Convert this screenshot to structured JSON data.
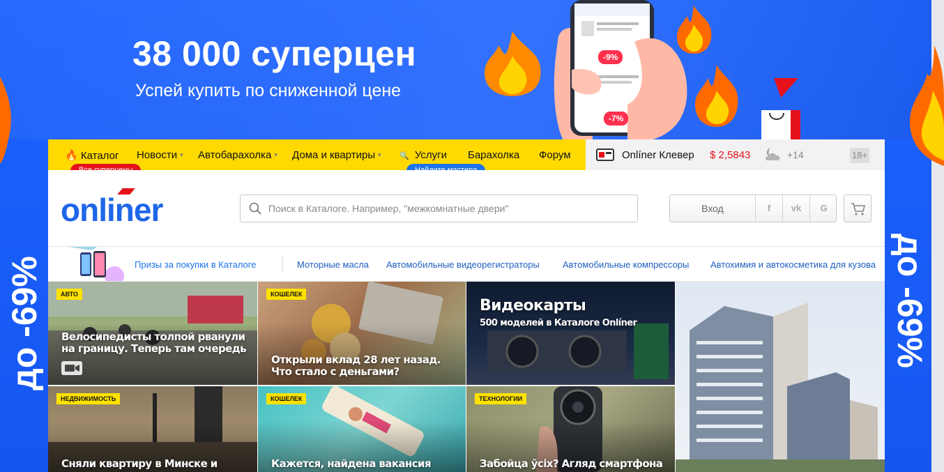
{
  "promo": {
    "title": "38 000 суперцен",
    "subtitle": "Успей купить по сниженной цене",
    "side_text": "до -69%",
    "phone_discounts": [
      "-9%",
      "-7%"
    ]
  },
  "topnav": {
    "items": [
      {
        "label": "Каталог",
        "has_caret": false
      },
      {
        "label": "Новости",
        "has_caret": true
      },
      {
        "label": "Автобарахолка",
        "has_caret": true
      },
      {
        "label": "Дома и квартиры",
        "has_caret": true
      },
      {
        "label": "Услуги",
        "has_caret": false
      },
      {
        "label": "Барахолка",
        "has_caret": false
      },
      {
        "label": "Форум",
        "has_caret": false
      }
    ],
    "catalog_pill": "Все суперцены",
    "services_pill": "Найдите мастера",
    "clever": "Onlíner Клевер",
    "currency_rate": "$ 2,5843",
    "weather": "+14",
    "age_rating": "18+"
  },
  "header": {
    "logo": "onliner",
    "search_placeholder": "Поиск в Каталоге. Например, \"межкомнатные двери\"",
    "login": "Вход",
    "social": [
      "f",
      "vk",
      "G"
    ]
  },
  "promobar": {
    "links": [
      "Призы за покупки в Каталоге",
      "Моторные масла",
      "Автомобильные видеорегистраторы",
      "Автомобильные компрессоры",
      "Автохимия и автокосметика для кузова"
    ]
  },
  "tiles": [
    {
      "badge": "АВТО",
      "title": "Велосипедисты толпой рванули на границу. Теперь там очередь"
    },
    {
      "badge": "КОШЕЛЕК",
      "title": "Открыли вклад 28 лет назад. Что стало с деньгами?"
    },
    {
      "badge": "",
      "title": "Видеокарты",
      "subtitle": "500 моделей в Каталоге Onlíner"
    },
    {
      "badge": "НЕДВИЖИМОСТЬ",
      "title": "Сняли квартиру в Минске и сильно"
    },
    {
      "badge": "КОШЕЛЕК",
      "title": "Кажется, найдена вакансия мечты."
    },
    {
      "badge": "ТЕХНОЛОГИИ",
      "title": "Забойца ўсіх? Агляд смартфона"
    }
  ],
  "colors": {
    "brand_blue": "#1e66e8",
    "nav_yellow": "#ffd900",
    "accent_red": "#e6121b",
    "badge_yellow": "#ffe200"
  }
}
